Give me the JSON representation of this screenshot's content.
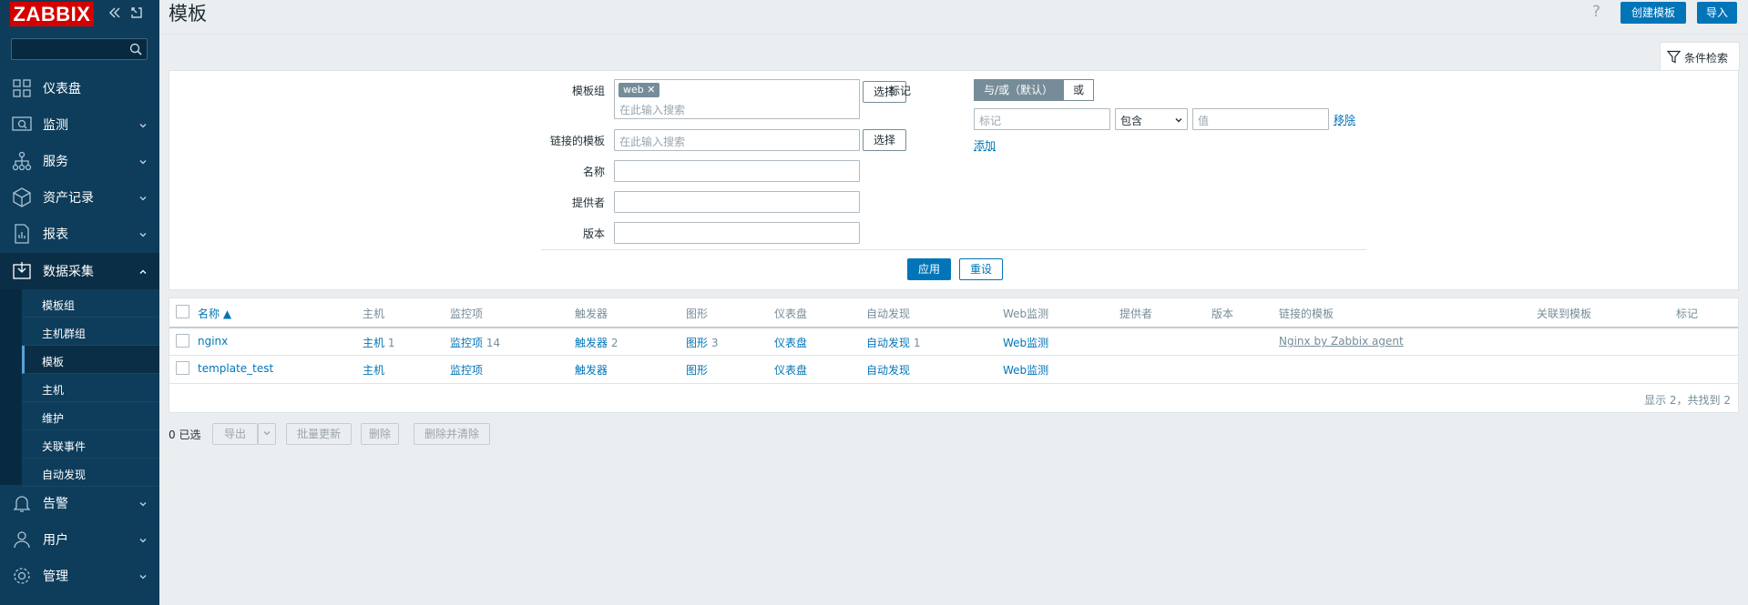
{
  "sidebar": {
    "logo": "ZABBIX",
    "nav": [
      {
        "label": "仪表盘",
        "icon": "dashboard-icon"
      },
      {
        "label": "监测",
        "icon": "monitoring-icon"
      },
      {
        "label": "服务",
        "icon": "services-icon"
      },
      {
        "label": "资产记录",
        "icon": "inventory-icon"
      },
      {
        "label": "报表",
        "icon": "reports-icon"
      },
      {
        "label": "数据采集",
        "icon": "data-collection-icon"
      },
      {
        "label": "告警",
        "icon": "alerts-icon"
      },
      {
        "label": "用户",
        "icon": "users-icon"
      },
      {
        "label": "管理",
        "icon": "administration-icon"
      }
    ],
    "submenu": [
      "模板组",
      "主机群组",
      "模板",
      "主机",
      "维护",
      "关联事件",
      "自动发现"
    ]
  },
  "header": {
    "title": "模板",
    "help": "?",
    "create_button": "创建模板",
    "import_button": "导入"
  },
  "filter": {
    "tab_label": "条件检索",
    "template_groups_label": "模板组",
    "template_groups_chip": "web",
    "search_placeholder": "在此输入搜索",
    "select_label": "选择",
    "linked_templates_label": "链接的模板",
    "name_label": "名称",
    "vendor_label": "提供者",
    "version_label": "版本",
    "tags_label": "标记",
    "tags_andor": "与/或（默认）",
    "tags_or": "或",
    "tag_placeholder": "标记",
    "tag_operator": "包含",
    "value_placeholder": "值",
    "remove_label": "移除",
    "add_label": "添加",
    "apply_button": "应用",
    "reset_button": "重设"
  },
  "table": {
    "columns": [
      "名称 ▲",
      "主机",
      "监控项",
      "触发器",
      "图形",
      "仪表盘",
      "自动发现",
      "Web监测",
      "提供者",
      "版本",
      "链接的模板",
      "关联到模板",
      "标记"
    ],
    "rows": [
      {
        "name": "nginx",
        "hosts": "主机",
        "hosts_count": "1",
        "items": "监控项",
        "items_count": "14",
        "triggers": "触发器",
        "triggers_count": "2",
        "graphs": "图形",
        "graphs_count": "3",
        "dashboards": "仪表盘",
        "discovery": "自动发现",
        "discovery_count": "1",
        "web": "Web监测",
        "linked": "Nginx by Zabbix agent"
      },
      {
        "name": "template_test",
        "hosts": "主机",
        "hosts_count": "",
        "items": "监控项",
        "items_count": "",
        "triggers": "触发器",
        "triggers_count": "",
        "graphs": "图形",
        "graphs_count": "",
        "dashboards": "仪表盘",
        "discovery": "自动发现",
        "discovery_count": "",
        "web": "Web监测",
        "linked": ""
      }
    ],
    "footer": "显示 2，共找到 2"
  },
  "bulk": {
    "selected": "0 已选",
    "export": "导出",
    "mass_update": "批量更新",
    "delete": "删除",
    "delete_clear": "删除并清除"
  }
}
